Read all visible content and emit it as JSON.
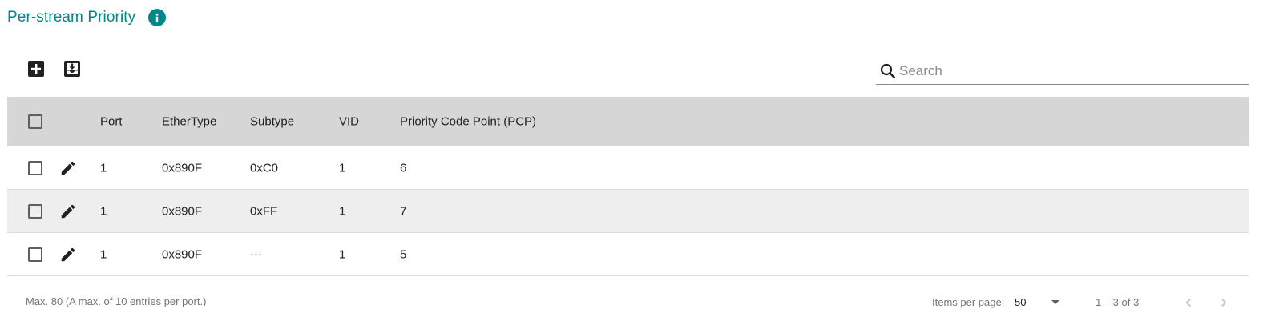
{
  "page": {
    "title": "Per-stream Priority"
  },
  "toolbar": {
    "add_icon": "add-box-icon",
    "import_icon": "inbox-download-icon"
  },
  "search": {
    "placeholder": "Search",
    "value": ""
  },
  "table": {
    "columns": [
      "Port",
      "EtherType",
      "Subtype",
      "VID",
      "Priority Code Point (PCP)"
    ],
    "rows": [
      {
        "port": "1",
        "ethertype": "0x890F",
        "subtype": "0xC0",
        "vid": "1",
        "pcp": "6"
      },
      {
        "port": "1",
        "ethertype": "0x890F",
        "subtype": "0xFF",
        "vid": "1",
        "pcp": "7"
      },
      {
        "port": "1",
        "ethertype": "0x890F",
        "subtype": "---",
        "vid": "1",
        "pcp": "5"
      }
    ]
  },
  "footer": {
    "note": "Max. 80 (A max. of 10 entries per port.)",
    "items_per_page_label": "Items per page:",
    "items_per_page_value": "50",
    "range": "1 – 3 of 3"
  },
  "colors": {
    "accent": "#008787",
    "header_bg": "#d6d6d6",
    "alt_row_bg": "#eeeeee"
  }
}
